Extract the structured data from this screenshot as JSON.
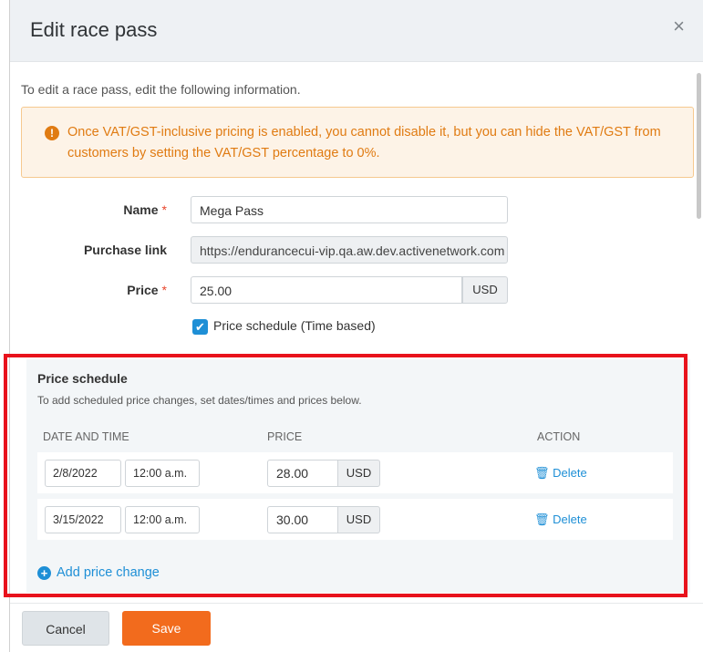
{
  "modal": {
    "title": "Edit race pass",
    "close_glyph": "×"
  },
  "intro": "To edit a race pass, edit the following information.",
  "warning": {
    "icon": "alert-circle-icon",
    "icon_glyph": "!",
    "text": "Once VAT/GST-inclusive pricing is enabled, you cannot disable it, but you can hide the VAT/GST from customers by setting the VAT/GST percentage to 0%."
  },
  "form": {
    "name_label": "Name",
    "name_value": "Mega Pass",
    "purchase_link_label": "Purchase link",
    "purchase_link_value": "https://endurancecui-vip.qa.aw.dev.activenetwork.com",
    "price_label": "Price",
    "price_value": "25.00",
    "currency": "USD",
    "required_mark": "*",
    "price_schedule_checkbox_label": "Price schedule (Time based)",
    "price_schedule_checked": true
  },
  "schedule": {
    "title": "Price schedule",
    "subtitle": "To add scheduled price changes, set dates/times and prices below.",
    "columns": [
      "DATE AND TIME",
      "PRICE",
      "ACTION"
    ],
    "rows": [
      {
        "date": "2/8/2022",
        "time": "12:00 a.m.",
        "price": "28.00",
        "currency": "USD",
        "action": "Delete"
      },
      {
        "date": "3/15/2022",
        "time": "12:00 a.m.",
        "price": "30.00",
        "currency": "USD",
        "action": "Delete"
      }
    ],
    "add_label": "Add price change"
  },
  "footer": {
    "cancel_label": "Cancel",
    "save_label": "Save"
  },
  "colors": {
    "accent_blue": "#1e8fd6",
    "save_orange": "#f26b1d",
    "warning_text": "#e07b12",
    "highlight_red": "#e8121c"
  }
}
